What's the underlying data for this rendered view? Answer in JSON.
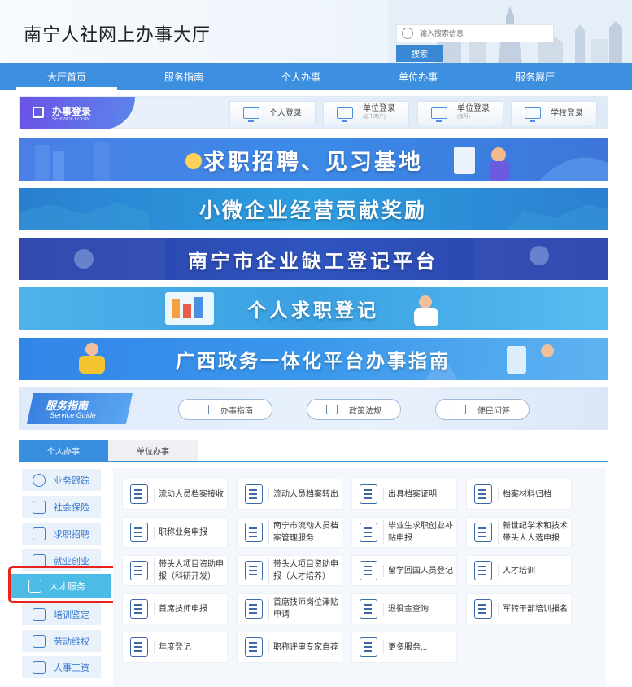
{
  "header": {
    "site_title": "南宁人社网上办事大厅",
    "search_placeholder": "输入搜索信息",
    "search_button": "搜索"
  },
  "nav": [
    "大厅首页",
    "服务指南",
    "个人办事",
    "单位办事",
    "服务展厅"
  ],
  "login": {
    "title": "办事登录",
    "subtitle": "SERVICE LOGIN",
    "buttons": [
      {
        "label": "个人登录",
        "sub": ""
      },
      {
        "label": "单位登录",
        "sub": "(证书用户)"
      },
      {
        "label": "单位登录",
        "sub": "(账号)"
      },
      {
        "label": "学校登录",
        "sub": ""
      }
    ]
  },
  "banners": [
    "求职招聘、见习基地",
    "小微企业经营贡献奖励",
    "南宁市企业缺工登记平台",
    "个人求职登记",
    "广西政务一体化平台办事指南"
  ],
  "guide": {
    "title": "服务指南",
    "subtitle": "Service Guide",
    "buttons": [
      "办事指南",
      "政策法规",
      "便民问答"
    ]
  },
  "tabs": [
    "个人办事",
    "单位办事"
  ],
  "sidebar": [
    {
      "label": "业务跟踪",
      "icon": "target-icon"
    },
    {
      "label": "社会保险",
      "icon": "insurance-icon"
    },
    {
      "label": "求职招聘",
      "icon": "job-seeker-icon"
    },
    {
      "label": "就业创业",
      "icon": "briefcase-icon"
    },
    {
      "label": "人才服务",
      "icon": "graduation-cap-icon"
    },
    {
      "label": "培训鉴定",
      "icon": "training-icon"
    },
    {
      "label": "劳动维权",
      "icon": "gavel-icon"
    },
    {
      "label": "人事工资",
      "icon": "payroll-icon"
    }
  ],
  "services": [
    "流动人员档案接收",
    "流动人员档案转出",
    "出具档案证明",
    "档案材料归档",
    "职称业务申报",
    "南宁市流动人员档案管理服务",
    "毕业生求职创业补贴申报",
    "新世纪学术和技术带头人人选申报",
    "带头人项目资助申报（科研开发）",
    "带头人项目资助申报（人才培养）",
    "留学回国人员登记",
    "人才培训",
    "首席技师申报",
    "首席技师岗位津贴申请",
    "退役金查询",
    "军转干部培训报名",
    "年度登记",
    "职称评审专家自荐",
    "更多服务..."
  ],
  "colors": {
    "nav_bg": "#3d8fe0",
    "active_side": "#4cbbe6",
    "highlight": "#e8231e"
  }
}
